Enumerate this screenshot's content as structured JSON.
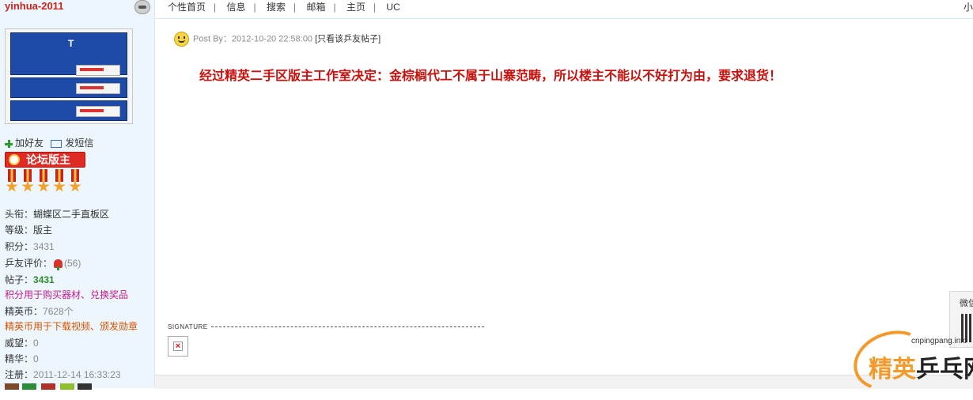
{
  "user": {
    "name": "yinhua-2011",
    "add_friend": "加好友",
    "send_message": "发短信",
    "badge": "论坛版主",
    "avatar_logo": "T",
    "info": {
      "title_label": "头衔：",
      "title_value": "蝴蝶区二手直板区",
      "level_label": "等级：",
      "level_value": "版主",
      "points_label": "积分：",
      "points_value": "3431",
      "rating_label": "乒友评价：",
      "rating_value": "(56)",
      "posts_label": "帖子：",
      "posts_value": "3431",
      "points_note": "积分用于购买器材、兑换奖品",
      "coins_label": "精英币：",
      "coins_value": "7628个",
      "coins_note": "精英币用于下载视频、颁发勋章",
      "prestige_label": "威望：",
      "prestige_value": "0",
      "essence_label": "精华：",
      "essence_value": "0",
      "register_label": "注册：",
      "register_value": "2011-12-14 16:33:23"
    }
  },
  "nav": {
    "items": [
      "个性首页",
      "信息",
      "搜索",
      "邮箱",
      "主页",
      "UC"
    ],
    "right_text": "小"
  },
  "post": {
    "meta_prefix": "Post By：",
    "timestamp": "2012-10-20 22:58:00",
    "only_author": "[只看该乒友帖子]",
    "body": "经过精英二手区版主工作室决定：金棕榈代工不属于山寨范畴，所以楼主不能以不好打为由，要求退货！",
    "signature_label": "SIGNATURE"
  },
  "side_widget": {
    "label": "微信"
  },
  "watermark": {
    "url": "cnpingpang.info",
    "text_orange": "精英",
    "text_dark": "乒乓网"
  },
  "colors": {
    "username": "#c8241c",
    "post_body": "#c8100c",
    "sidebar_bg": "#eef6fd",
    "posts_count": "#2a8a2a",
    "points_note": "#c21b8e",
    "coins_note": "#d35400",
    "watermark_orange": "#f39a2a"
  }
}
